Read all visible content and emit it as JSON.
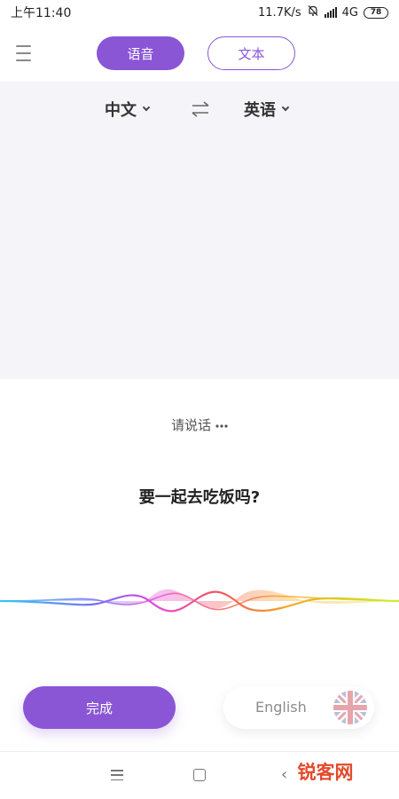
{
  "status_bar": {
    "time": "上午11:40",
    "network_speed": "11.7K/s",
    "network_type": "4G",
    "battery_level": "78"
  },
  "tabs": {
    "voice_label": "语音",
    "text_label": "文本"
  },
  "languages": {
    "source": "中文",
    "target": "英语"
  },
  "speech": {
    "prompt": "请说话",
    "recognized_text": "要一起去吃饭吗?"
  },
  "actions": {
    "done_label": "完成",
    "language_pill_label": "English"
  },
  "watermark": {
    "text": "锐客网"
  },
  "colors": {
    "accent": "#8a56d6",
    "panel_background": "#f5f4f9",
    "wave_gradient": [
      "#36c7f0",
      "#7b6cf6",
      "#e84bd3",
      "#f2565a",
      "#f5a623",
      "#c8f02c"
    ]
  },
  "icons": {
    "menu": "menu-icon",
    "swap": "swap-arrows-icon",
    "mute": "bell-off-icon",
    "flag": "uk-flag-icon"
  }
}
